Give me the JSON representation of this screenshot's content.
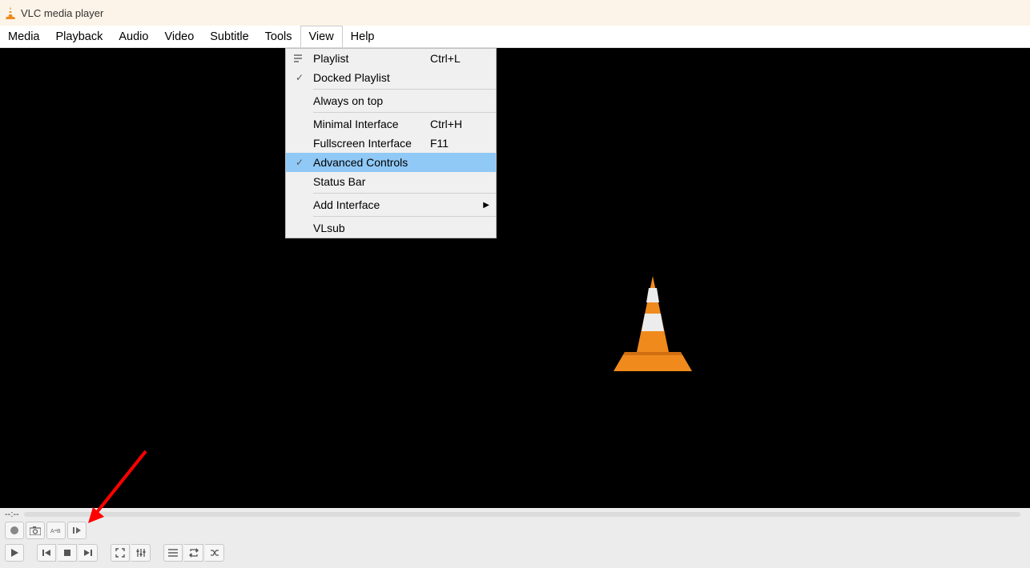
{
  "title": "VLC media player",
  "menubar": [
    "Media",
    "Playback",
    "Audio",
    "Video",
    "Subtitle",
    "Tools",
    "View",
    "Help"
  ],
  "activeMenuIndex": 6,
  "viewMenu": {
    "playlist": {
      "label": "Playlist",
      "shortcut": "Ctrl+L",
      "icon": "playlist"
    },
    "docked": {
      "label": "Docked Playlist",
      "checked": true
    },
    "alwaystop": {
      "label": "Always on top"
    },
    "minimal": {
      "label": "Minimal Interface",
      "shortcut": "Ctrl+H"
    },
    "fullscreen": {
      "label": "Fullscreen Interface",
      "shortcut": "F11"
    },
    "advanced": {
      "label": "Advanced Controls",
      "checked": true,
      "highlighted": true
    },
    "statusbar": {
      "label": "Status Bar"
    },
    "addinterface": {
      "label": "Add Interface",
      "submenu": true
    },
    "vlsub": {
      "label": "VLsub"
    }
  },
  "time": {
    "elapsed": "--:--"
  },
  "advControls": {
    "record": "record",
    "snapshot": "snapshot",
    "loop": "loop-ab",
    "frame": "frame-step"
  },
  "mainControls": {
    "play": "play",
    "prev": "previous",
    "stop": "stop",
    "next": "next",
    "fullscreen": "fullscreen",
    "ext": "extended-settings",
    "playlist": "playlist-toggle",
    "repeat": "repeat",
    "shuffle": "shuffle"
  }
}
